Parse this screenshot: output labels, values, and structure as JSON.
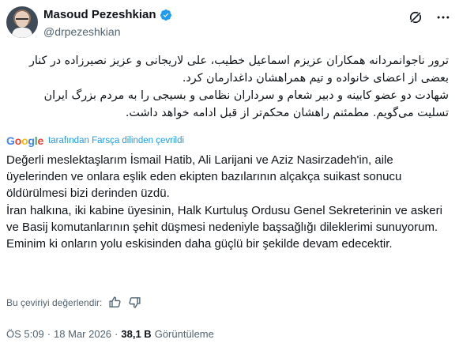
{
  "author": {
    "name": "Masoud Pezeshkian",
    "handle": "@drpezeshkian"
  },
  "original_text": {
    "line1": "ترور ناجوانمردانه همکاران عزیزم اسماعیل خطیب، علی لاریجانی و عزیز نصیرزاده در کنار",
    "line2": "بعضی از اعضای خانواده و تیم همراهشان داغدارمان کرد.",
    "line3": "شهادت دو عضو کابینه و دبیر شعام و سرداران نظامی و بسیجی را به مردم بزرگ ایران",
    "line4": "تسلیت می‌گویم. مطمئنم راهشان محکم‌تر از قبل ادامه خواهد داشت."
  },
  "translation": {
    "google_label": "Google",
    "note": "tarafından Farsça dilinden çevrildi",
    "paragraph1": "Değerli meslektaşlarım İsmail Hatib, Ali Larijani ve Aziz Nasirzadeh'in, aile üyelerinden ve onlara eşlik eden ekipten bazılarının alçakça suikast sonucu öldürülmesi bizi derinden üzdü.",
    "paragraph2": "İran halkına, iki kabine üyesinin, Halk Kurtuluş Ordusu Genel Sekreterinin ve askeri ve Basij komutanlarının şehit düşmesi nedeniyle başsağlığı dileklerimi sunuyorum. Eminim ki onların yolu eskisinden daha güçlü bir şekilde devam edecektir."
  },
  "rating": {
    "prompt": "Bu çeviriyi değerlendir:",
    "icons": [
      "thumbs-up-icon",
      "thumbs-down-icon"
    ]
  },
  "meta": {
    "time": "ÖS 5:09",
    "date": "18 Mar 2026",
    "views_count": "38,1 B",
    "views_label": "Görüntüleme",
    "separator": "·"
  },
  "icons": {
    "verified": "verified-badge-icon",
    "grok": "grok-icon",
    "more": "more-icon"
  },
  "colors": {
    "accent": "#1d9bf0",
    "text": "#0f1419",
    "muted": "#536471"
  }
}
